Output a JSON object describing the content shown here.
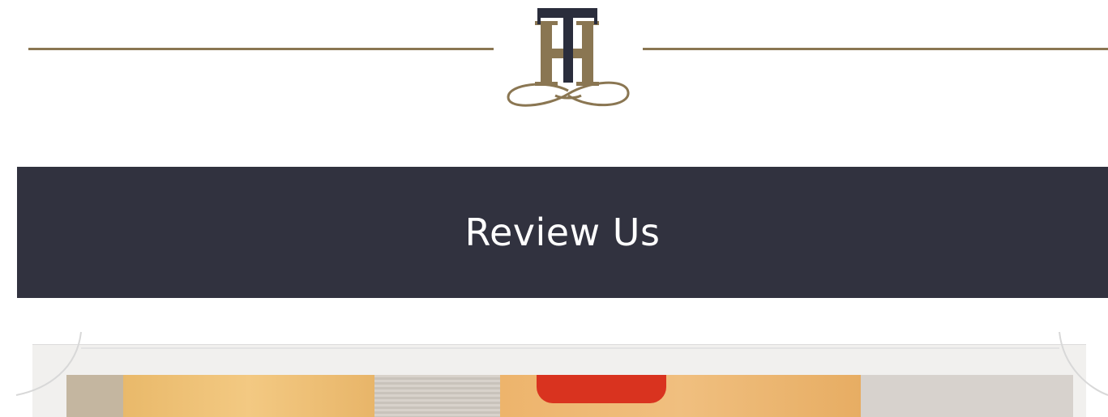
{
  "colors": {
    "gold": "#8a7652",
    "banner": "#31323f",
    "navy": "#2a2d3c"
  },
  "header": {
    "logo_icon": "th-monogram-icon"
  },
  "banner": {
    "title": "Review Us"
  },
  "photo": {
    "icon": "photo-strip-image"
  }
}
